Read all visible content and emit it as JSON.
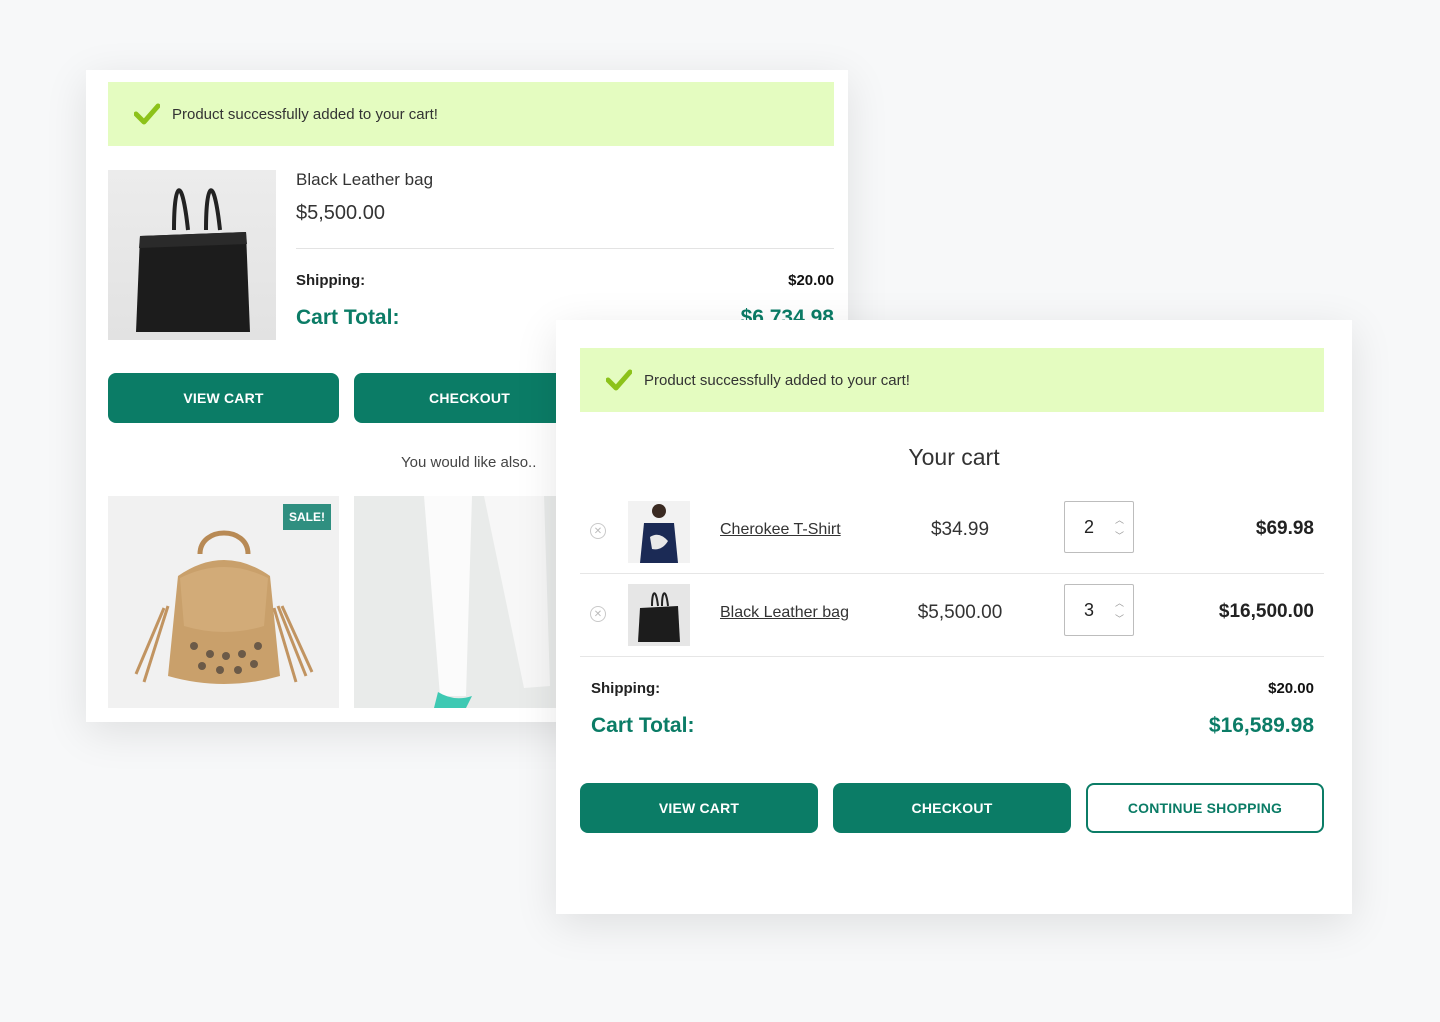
{
  "notice": {
    "message": "Product successfully added to your cart!"
  },
  "mini_cart": {
    "product_name": "Black Leather bag",
    "product_price": "$5,500.00",
    "shipping_label": "Shipping:",
    "shipping_value": "$20.00",
    "total_label": "Cart Total:",
    "total_value": "$6,734.98",
    "view_cart": "VIEW CART",
    "checkout": "CHECKOUT",
    "suggest_title": "You would like also..",
    "sale_badge": "SALE!"
  },
  "cart": {
    "title": "Your cart",
    "items": [
      {
        "name": "Cherokee T-Shirt",
        "price": "$34.99",
        "qty": "2",
        "subtotal": "$69.98"
      },
      {
        "name": "Black Leather bag",
        "price": "$5,500.00",
        "qty": "3",
        "subtotal": "$16,500.00"
      }
    ],
    "shipping_label": "Shipping:",
    "shipping_value": "$20.00",
    "total_label": "Cart Total:",
    "total_value": "$16,589.98",
    "view_cart": "VIEW CART",
    "checkout": "CHECKOUT",
    "continue": "CONTINUE SHOPPING"
  },
  "colors": {
    "accent": "#0b7c66",
    "notice_bg": "#e4fcc0",
    "check": "#8cc21a"
  }
}
